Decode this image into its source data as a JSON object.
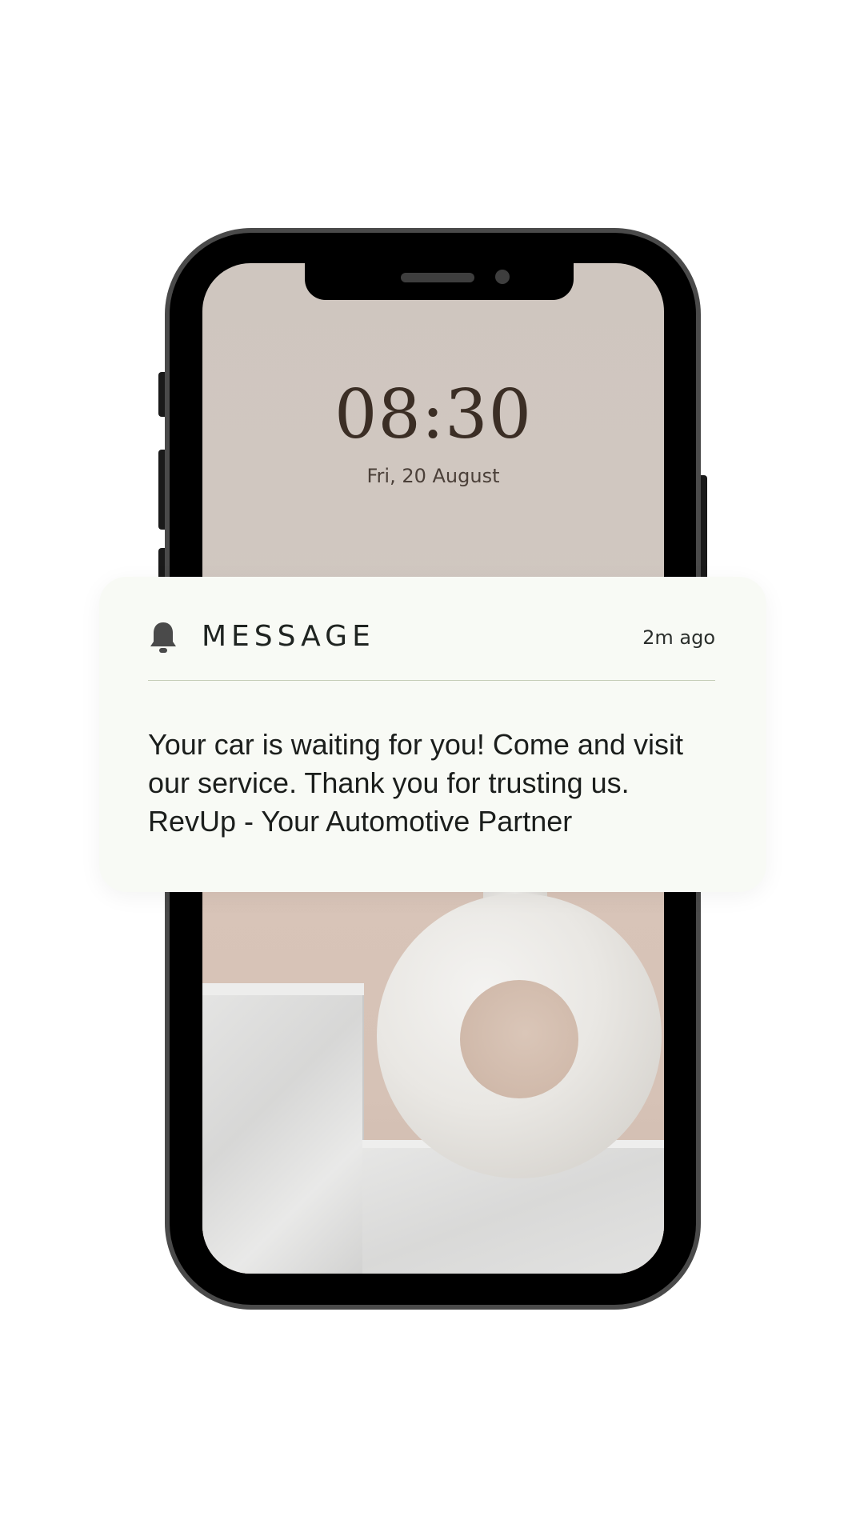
{
  "lock_screen": {
    "time": "08:30",
    "date": "Fri, 20 August"
  },
  "notification": {
    "icon": "bell-icon",
    "title": "MESSAGE",
    "timestamp": "2m ago",
    "body": "Your car is waiting for you! Come and visit our service. Thank you for trusting us. RevUp - Your Automotive Partner"
  },
  "colors": {
    "card_background": "#f8faf5",
    "divider": "#c5cdb8",
    "clock_text": "#3b2e25",
    "phone_frame": "#4a4a4a"
  }
}
